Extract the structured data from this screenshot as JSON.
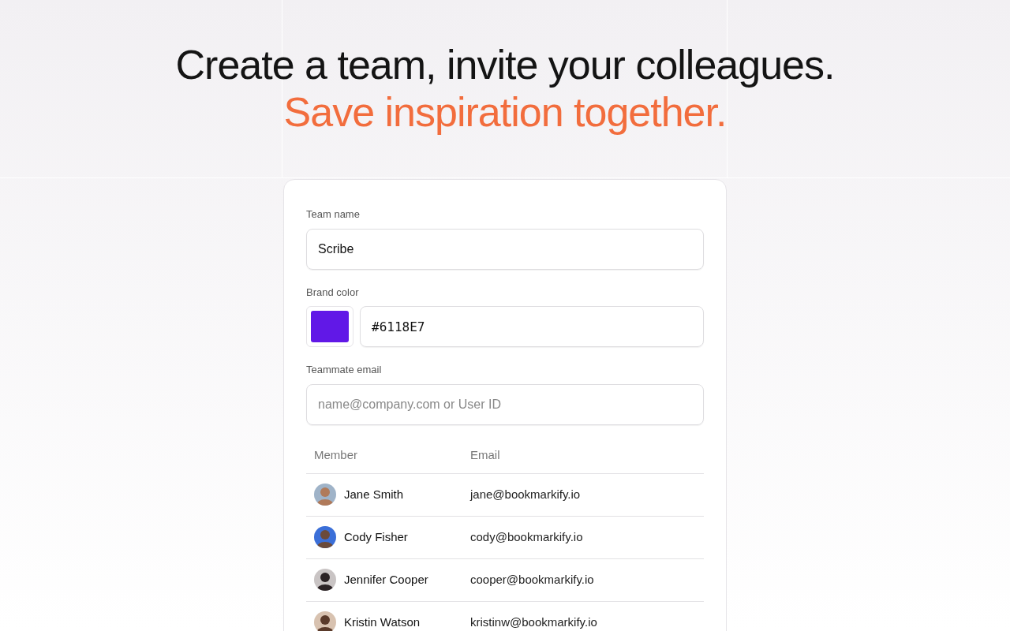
{
  "headline": {
    "line_1": "Create a team, invite your colleagues.",
    "line_2": "Save inspiration together."
  },
  "form": {
    "team_name": {
      "label": "Team name",
      "value": "Scribe"
    },
    "brand_color": {
      "label": "Brand color",
      "value": "#6118E7"
    },
    "teammate_email": {
      "label": "Teammate email",
      "placeholder": "name@company.com or User ID"
    }
  },
  "table": {
    "columns": [
      "Member",
      "Email"
    ],
    "rows": [
      {
        "member": "Jane Smith",
        "email": "jane@bookmarkify.io"
      },
      {
        "member": "Cody Fisher",
        "email": "cody@bookmarkify.io"
      },
      {
        "member": "Jennifer Cooper",
        "email": "cooper@bookmarkify.io"
      },
      {
        "member": "Kristin Watson",
        "email": "kristinw@bookmarkify.io"
      }
    ]
  }
}
